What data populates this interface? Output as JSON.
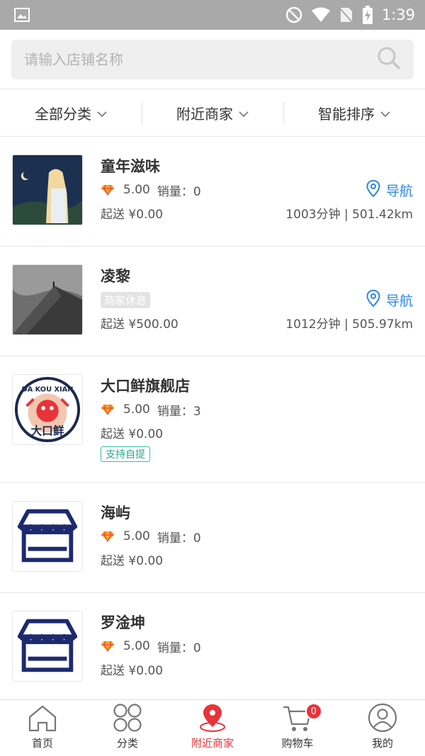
{
  "status_bar": {
    "time": "1:39"
  },
  "search": {
    "placeholder": "请输入店铺名称"
  },
  "filters": [
    {
      "label": "全部分类"
    },
    {
      "label": "附近商家"
    },
    {
      "label": "智能排序"
    }
  ],
  "stores": [
    {
      "name": "童年滋味",
      "rating": "5.00",
      "sales": "销量：0",
      "min_order": "起送 ¥0.00",
      "nav_label": "导航",
      "distance": "1003分钟 | 501.42km"
    },
    {
      "name": "凌黎",
      "status_tag": "商家休息",
      "min_order": "起送 ¥500.00",
      "nav_label": "导航",
      "distance": "1012分钟 | 505.97km"
    },
    {
      "name": "大口鲜旗舰店",
      "rating": "5.00",
      "sales": "销量：3",
      "min_order": "起送 ¥0.00",
      "pickup_tag": "支持自提",
      "logo_text": "DA KOU XIAN",
      "logo_text_cn": "大口鲜"
    },
    {
      "name": "海屿",
      "rating": "5.00",
      "sales": "销量：0",
      "min_order": "起送 ¥0.00"
    },
    {
      "name": "罗淦坤",
      "rating": "5.00",
      "sales": "销量：0",
      "min_order": "起送 ¥0.00"
    }
  ],
  "tabbar": [
    {
      "label": "首页",
      "icon": "home-icon"
    },
    {
      "label": "分类",
      "icon": "category-icon"
    },
    {
      "label": "附近商家",
      "icon": "location-pin-icon"
    },
    {
      "label": "购物车",
      "icon": "cart-icon",
      "badge": "0"
    },
    {
      "label": "我的",
      "icon": "user-icon"
    }
  ],
  "colors": {
    "accent": "#e8333a",
    "nav_blue": "#2a86e0",
    "pickup_green": "#21a98a",
    "rating_gem": "#f5a623"
  }
}
